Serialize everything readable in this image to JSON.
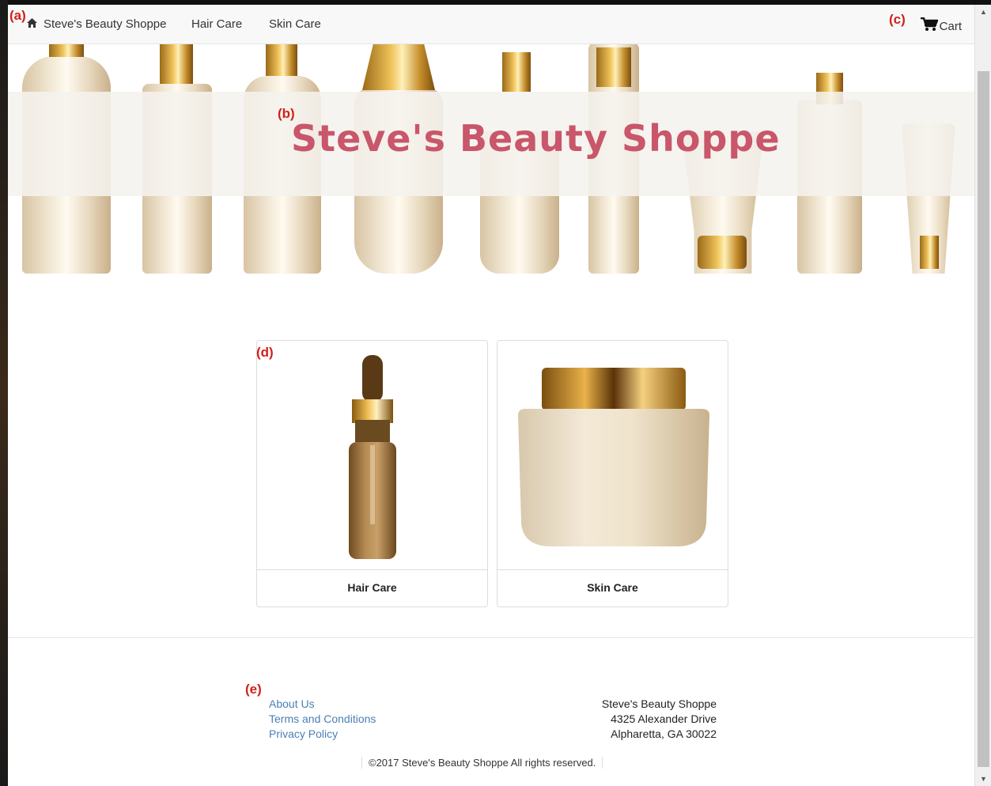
{
  "annotations": {
    "a": "(a)",
    "b": "(b)",
    "c": "(c)",
    "d": "(d)",
    "e": "(e)"
  },
  "navbar": {
    "brand": "Steve's Beauty Shoppe",
    "brand_icon": "home-icon",
    "links": [
      "Hair Care",
      "Skin Care"
    ],
    "cart_label": "Cart",
    "cart_icon": "shopping-cart-icon"
  },
  "hero": {
    "title": "Steve's Beauty Shoppe"
  },
  "categories": [
    {
      "label": "Hair Care",
      "image": "dropper-bottle"
    },
    {
      "label": "Skin Care",
      "image": "cream-jar"
    }
  ],
  "footer": {
    "links": [
      "About Us",
      "Terms and Conditions",
      "Privacy Policy"
    ],
    "address": [
      "Steve's Beauty Shoppe",
      "4325 Alexander Drive",
      "Alpharetta, GA 30022"
    ],
    "copyright": "©2017 Steve's Beauty Shoppe All rights reserved."
  },
  "colors": {
    "accent_link": "#4a7fb5",
    "hero_title": "#c9566a",
    "annotation": "#d0201a",
    "gold": "#d4a640"
  }
}
